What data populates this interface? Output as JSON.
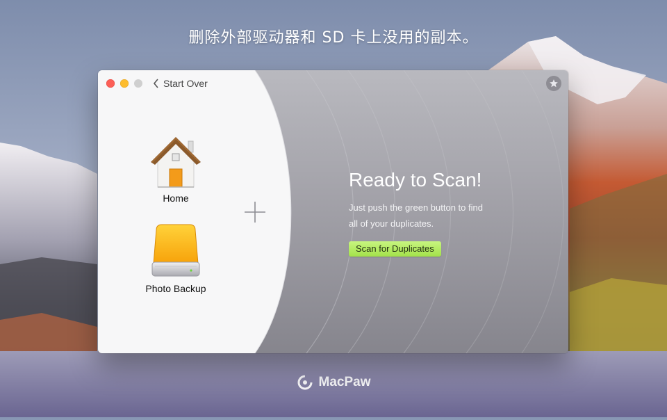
{
  "headline": "删除外部驱动器和 SD 卡上没用的副本。",
  "brand": {
    "name": "MacPaw",
    "icon": "macpaw-logo-icon"
  },
  "window": {
    "traffic_lights": [
      "close",
      "minimize",
      "zoom"
    ],
    "start_over_label": "Start Over",
    "folders": [
      {
        "label": "Home",
        "icon": "home-folder-icon"
      },
      {
        "label": "Photo Backup",
        "icon": "external-drive-icon"
      }
    ],
    "add_icon": "plus-icon",
    "star_icon": "star-icon",
    "ready_title": "Ready to Scan!",
    "description_line1": "Just push the green button to find",
    "description_line2": "all of your duplicates.",
    "scan_button_label": "Scan for Duplicates"
  },
  "colors": {
    "scan_button": "#a3e24a",
    "close": "#fc5f57",
    "minimize": "#fdbc2e"
  }
}
